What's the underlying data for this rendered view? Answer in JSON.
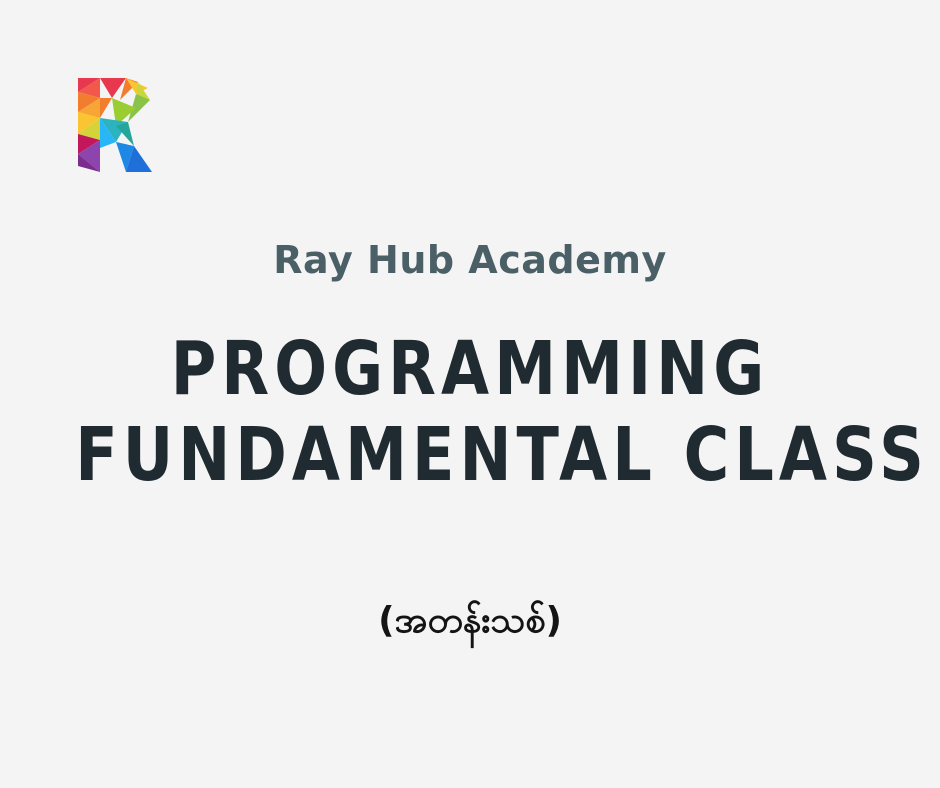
{
  "logo": {
    "icon": "r-letter-logo-icon",
    "colors": [
      "#e8384f",
      "#f27d2e",
      "#fbc531",
      "#8bc34a",
      "#2bb3c0",
      "#1e6fd9",
      "#8e44ad",
      "#c2185b"
    ]
  },
  "header": {
    "org_name": "Ray Hub Academy"
  },
  "main": {
    "title_line1": "PROGRAMMING",
    "title_line2": "FUNDAMENTAL CLASS",
    "subtitle": "(အတန်းသစ်)"
  },
  "theme": {
    "background": "#f4f4f4",
    "org_color": "#4a5f66",
    "title_color": "#1f2b30"
  }
}
